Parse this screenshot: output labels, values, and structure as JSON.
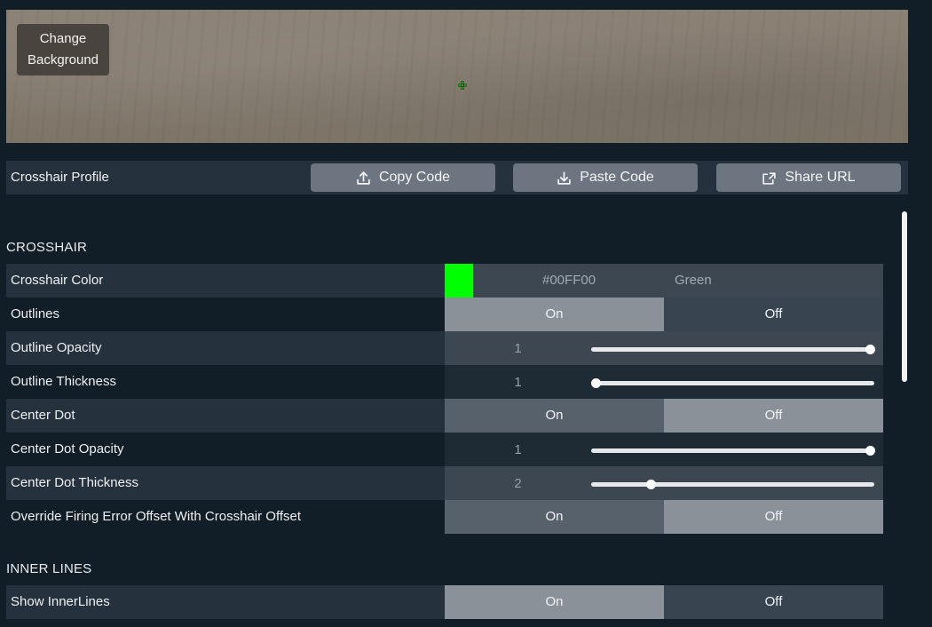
{
  "preview": {
    "change_background_line1": "Change",
    "change_background_line2": "Background"
  },
  "profile_bar": {
    "label": "Crosshair Profile",
    "copy_label": "Copy Code",
    "paste_label": "Paste Code",
    "share_label": "Share URL"
  },
  "crosshair_section": {
    "title": "CROSSHAIR",
    "color": {
      "label": "Crosshair Color",
      "hex": "#00FF00",
      "name": "Green",
      "swatch": "#00ff00"
    },
    "outlines": {
      "label": "Outlines",
      "on": "On",
      "off": "Off",
      "selected": "On"
    },
    "outline_opacity": {
      "label": "Outline Opacity",
      "value": "1",
      "fraction": 1.0
    },
    "outline_thickness": {
      "label": "Outline Thickness",
      "value": "1",
      "fraction": 0.0
    },
    "center_dot": {
      "label": "Center Dot",
      "on": "On",
      "off": "Off",
      "selected": "Off"
    },
    "center_dot_opacity": {
      "label": "Center Dot Opacity",
      "value": "1",
      "fraction": 1.0
    },
    "center_dot_thickness": {
      "label": "Center Dot Thickness",
      "value": "2",
      "fraction": 0.2
    },
    "override_firing_error": {
      "label": "Override Firing Error Offset With Crosshair Offset",
      "on": "On",
      "off": "Off",
      "selected": "Off"
    }
  },
  "inner_lines_section": {
    "title": "INNER LINES",
    "show_inner_lines": {
      "label": "Show InnerLines",
      "on": "On",
      "off": "Off",
      "selected": "On"
    }
  },
  "colors": {
    "background": "#111d27",
    "row_dark": "#25313c",
    "toggle_selected": "#8a9199",
    "toggle_unselected": "#56616c",
    "crosshair_green": "#00ff00"
  }
}
